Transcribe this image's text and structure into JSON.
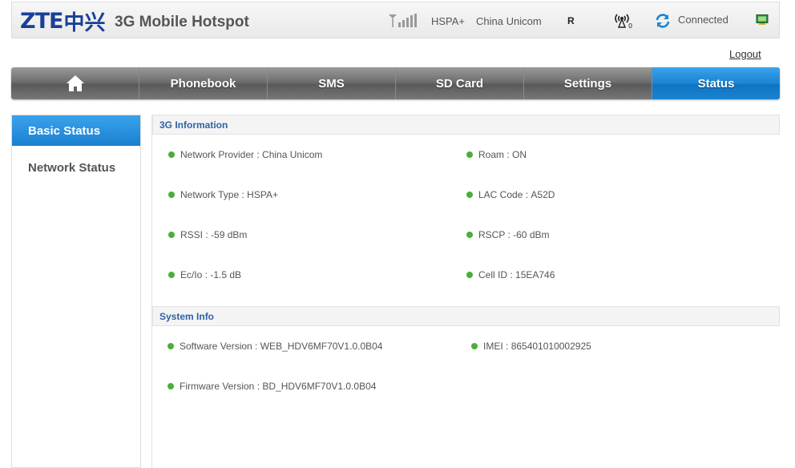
{
  "header": {
    "logo_text": "ZTE",
    "logo_cn": "中兴",
    "product_title": "3G Mobile Hotspot",
    "network_type": "HSPA+",
    "provider": "China Unicom",
    "roam_flag": "R",
    "connection_status": "Connected",
    "icons": [
      "signal-strength-icon",
      "wifi-clients-icon",
      "connection-sync-icon",
      "screen-icon"
    ]
  },
  "logout_label": "Logout",
  "nav": {
    "home_icon": "home-icon",
    "items": [
      "Phonebook",
      "SMS",
      "SD Card",
      "Settings",
      "Status"
    ],
    "active": "Status"
  },
  "sidebar": {
    "items": [
      "Basic Status",
      "Network Status"
    ],
    "active": "Basic Status"
  },
  "sections": {
    "g3": {
      "title": "3G Information",
      "left": [
        {
          "label": "Network Provider :",
          "value": "China Unicom"
        },
        {
          "label": "Network Type :",
          "value": "HSPA+"
        },
        {
          "label": "RSSI :",
          "value": "-59 dBm"
        },
        {
          "label": "Ec/Io  :",
          "value": "-1.5 dB"
        }
      ],
      "right": [
        {
          "label": "Roam :",
          "value": "ON"
        },
        {
          "label": "LAC Code  :",
          "value": "A52D"
        },
        {
          "label": "RSCP :",
          "value": "-60 dBm"
        },
        {
          "label": "Cell ID  :",
          "value": "15EA746"
        }
      ]
    },
    "sys": {
      "title": "System Info",
      "left": [
        {
          "label": "Software Version :",
          "value": "WEB_HDV6MF70V1.0.0B04"
        },
        {
          "label": "Firmware Version :",
          "value": "BD_HDV6MF70V1.0.0B04"
        }
      ],
      "right": [
        {
          "label": "IMEI :",
          "value": "865401010002925"
        }
      ]
    }
  },
  "colors": {
    "accent_blue": "#1b84d4",
    "section_title": "#2f62a6",
    "status_dot": "#4cae3a",
    "logo_blue": "#1a3f9a"
  }
}
